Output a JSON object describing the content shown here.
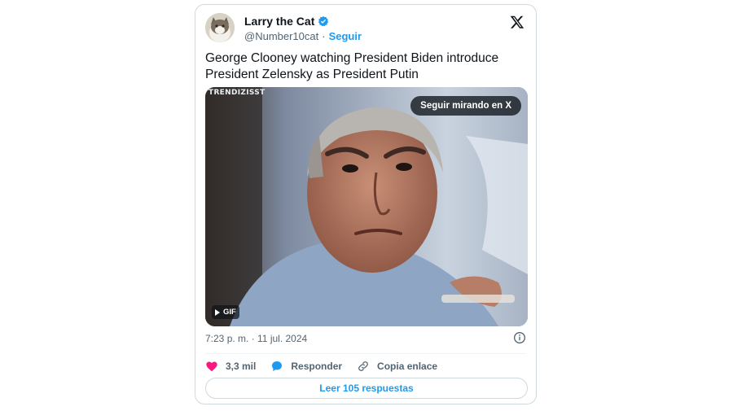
{
  "author": {
    "display_name": "Larry the Cat",
    "handle": "@Number10cat",
    "separator": "·",
    "follow_label": "Seguir"
  },
  "tweet": {
    "text": "George Clooney watching President Biden introduce President Zelensky as President Putin"
  },
  "media": {
    "source_label": "TRENDIZISST",
    "watch_label": "Seguir mirando en X",
    "gif_label": "GIF"
  },
  "meta": {
    "timestamp": "7:23 p. m. · 11 jul. 2024"
  },
  "actions": {
    "likes": "3,3 mil",
    "reply_label": "Responder",
    "copy_label": "Copia enlace"
  },
  "read_replies_label": "Leer 105 respuestas",
  "colors": {
    "accent": "#1d9bf0",
    "like": "#f91880",
    "text": "#0f1419",
    "muted": "#536471"
  }
}
